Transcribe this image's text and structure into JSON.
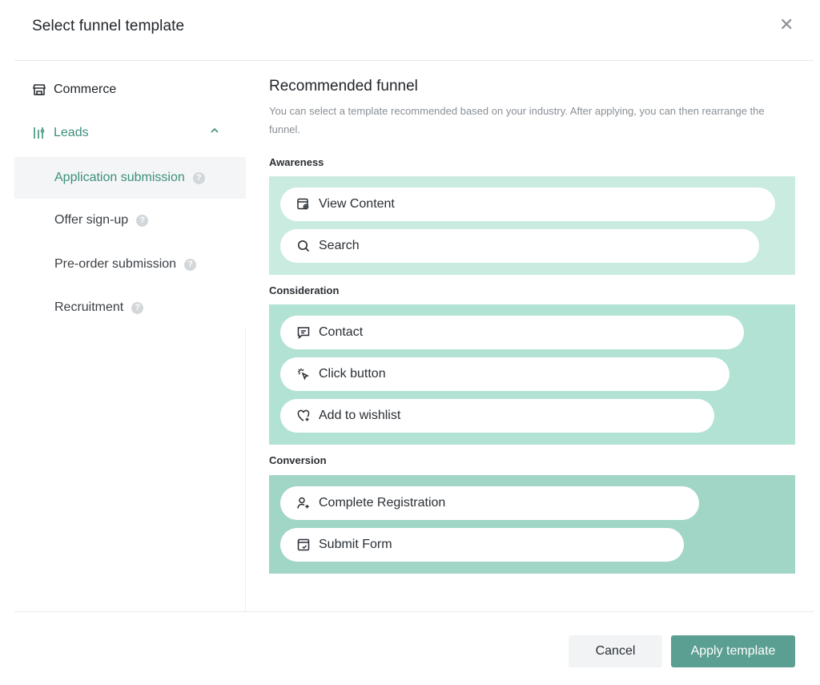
{
  "dialog": {
    "title": "Select funnel template",
    "close_symbol": "✕"
  },
  "sidebar": {
    "categories": [
      {
        "label": "Commerce",
        "icon": "store-icon"
      },
      {
        "label": "Leads",
        "icon": "funnel-icon",
        "expanded": true
      }
    ],
    "items": [
      {
        "label": "Application submission",
        "active": true
      },
      {
        "label": "Offer sign-up"
      },
      {
        "label": "Pre-order submission"
      },
      {
        "label": "Recruitment"
      }
    ]
  },
  "main": {
    "title": "Recommended funnel",
    "description": "You can select a template recommended based on your industry. After applying, you can then rearrange the funnel.",
    "stages": [
      {
        "label": "Awareness",
        "color": "#c9ebe0",
        "events": [
          {
            "label": "View Content",
            "icon": "view-content-icon"
          },
          {
            "label": "Search",
            "icon": "search-icon"
          }
        ]
      },
      {
        "label": "Consideration",
        "color": "#b2e2d3",
        "events": [
          {
            "label": "Contact",
            "icon": "message-icon"
          },
          {
            "label": "Click button",
            "icon": "click-icon"
          },
          {
            "label": "Add to wishlist",
            "icon": "heart-icon"
          }
        ]
      },
      {
        "label": "Conversion",
        "color": "#a1d6c6",
        "events": [
          {
            "label": "Complete Registration",
            "icon": "user-add-icon"
          },
          {
            "label": "Submit Form",
            "icon": "form-icon"
          }
        ]
      }
    ]
  },
  "footer": {
    "cancel_label": "Cancel",
    "apply_label": "Apply template"
  },
  "colors": {
    "accent": "#3d8f7c",
    "apply_button": "#5b9e92"
  }
}
